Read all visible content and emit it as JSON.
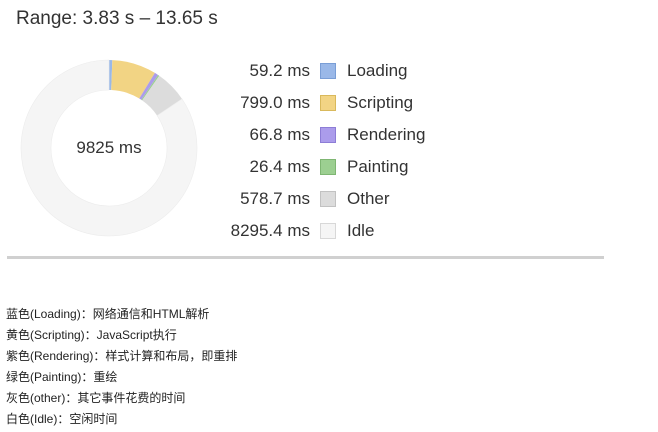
{
  "range_title": "Range: 3.83 s – 13.65 s",
  "total_label": "9825 ms",
  "legend": [
    {
      "value": "59.2 ms",
      "label": "Loading",
      "ms": 59.2,
      "color": "#9ab8e8",
      "border": "#7a9ed6"
    },
    {
      "value": "799.0 ms",
      "label": "Scripting",
      "ms": 799.0,
      "color": "#f2d484",
      "border": "#d9b95c"
    },
    {
      "value": "66.8 ms",
      "label": "Rendering",
      "ms": 66.8,
      "color": "#ab9ceb",
      "border": "#8d7dd6"
    },
    {
      "value": "26.4 ms",
      "label": "Painting",
      "ms": 26.4,
      "color": "#9ccf91",
      "border": "#7fb673"
    },
    {
      "value": "578.7 ms",
      "label": "Other",
      "ms": 578.7,
      "color": "#dcdcdc",
      "border": "#c2c2c2"
    },
    {
      "value": "8295.4 ms",
      "label": "Idle",
      "ms": 8295.4,
      "color": "#f5f5f5",
      "border": "#d8d8d8"
    }
  ],
  "notes": [
    "蓝色(Loading)：网络通信和HTML解析",
    "黄色(Scripting)：JavaScript执行",
    "紫色(Rendering)：样式计算和布局，即重排",
    "绿色(Painting)：重绘",
    "灰色(other)：其它事件花费的时间",
    "白色(Idle)：空闲时间"
  ]
}
